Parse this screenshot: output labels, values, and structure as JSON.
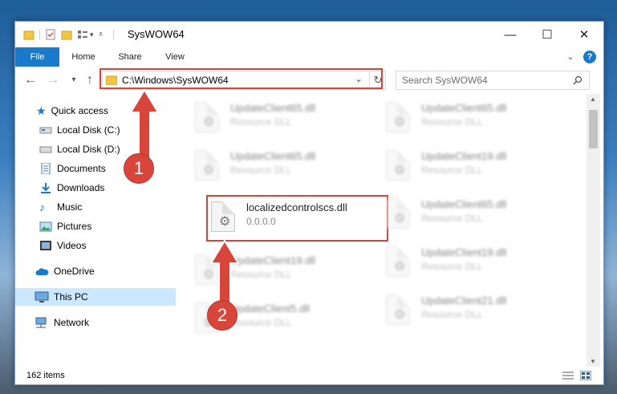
{
  "window": {
    "title": "SysWOW64",
    "minimize": "—",
    "maximize": "☐",
    "close": "✕"
  },
  "ribbon": {
    "tabs": [
      "File",
      "Home",
      "Share",
      "View"
    ],
    "expand": "⌄",
    "help": "?"
  },
  "address": {
    "path": "C:\\Windows\\SysWOW64",
    "search_placeholder": "Search SysWOW64"
  },
  "nav": {
    "items": [
      {
        "label": "Quick access"
      },
      {
        "label": "Local Disk (C:)"
      },
      {
        "label": "Local Disk (D:)"
      },
      {
        "label": "Documents"
      },
      {
        "label": "Downloads"
      },
      {
        "label": "Music"
      },
      {
        "label": "Pictures"
      },
      {
        "label": "Videos"
      },
      {
        "label": "OneDrive"
      },
      {
        "label": "This PC"
      },
      {
        "label": "Network"
      }
    ]
  },
  "files": {
    "left": [
      {
        "name": "UpdateClient65.dll",
        "type": "Resource DLL"
      },
      {
        "name": "UpdateClient65.dll",
        "type": "Resource DLL"
      },
      {
        "name": "localizedcontrolscs.dll",
        "type": "0.0.0.0"
      },
      {
        "name": "UpdateClient19.dll",
        "type": "Resource DLL"
      },
      {
        "name": "UpdateClient5.dll",
        "type": "Resource DLL"
      }
    ],
    "right": [
      {
        "name": "UpdateClient65.dll",
        "type": "Resource DLL"
      },
      {
        "name": "UpdateClient19.dll",
        "type": "Resource DLL"
      },
      {
        "name": "UpdateClient65.dll",
        "type": "Resource DLL"
      },
      {
        "name": "UpdateClient19.dll",
        "type": "Resource DLL"
      },
      {
        "name": "UpdateClient21.dll",
        "type": "Resource DLL"
      }
    ]
  },
  "status": {
    "count": "162 items"
  },
  "annotations": {
    "badge1": "1",
    "badge2": "2"
  },
  "colors": {
    "accent": "#1979ca",
    "highlight": "#d9443a",
    "selected": "#cce8ff"
  }
}
